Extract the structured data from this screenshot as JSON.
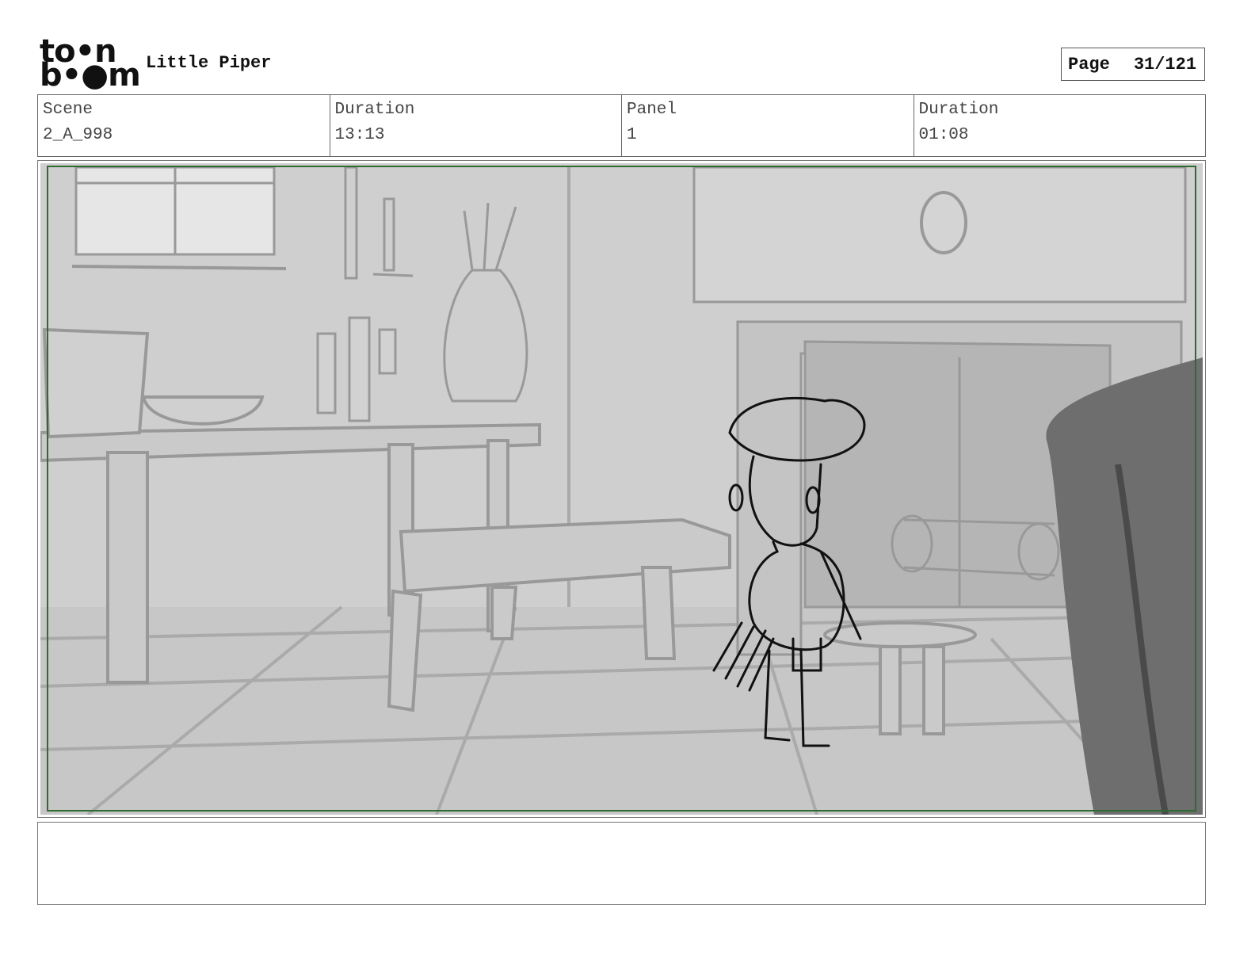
{
  "header": {
    "logo_line1": "to•n",
    "logo_line2": "b•●m",
    "title": "Little Piper",
    "page_label": "Page",
    "page_number": "31/121"
  },
  "info": [
    {
      "label": "Scene",
      "value": "2_A_998"
    },
    {
      "label": "Duration",
      "value": "13:13"
    },
    {
      "label": "Panel",
      "value": "1"
    },
    {
      "label": "Duration",
      "value": "01:08"
    }
  ],
  "notes": {
    "text": ""
  }
}
